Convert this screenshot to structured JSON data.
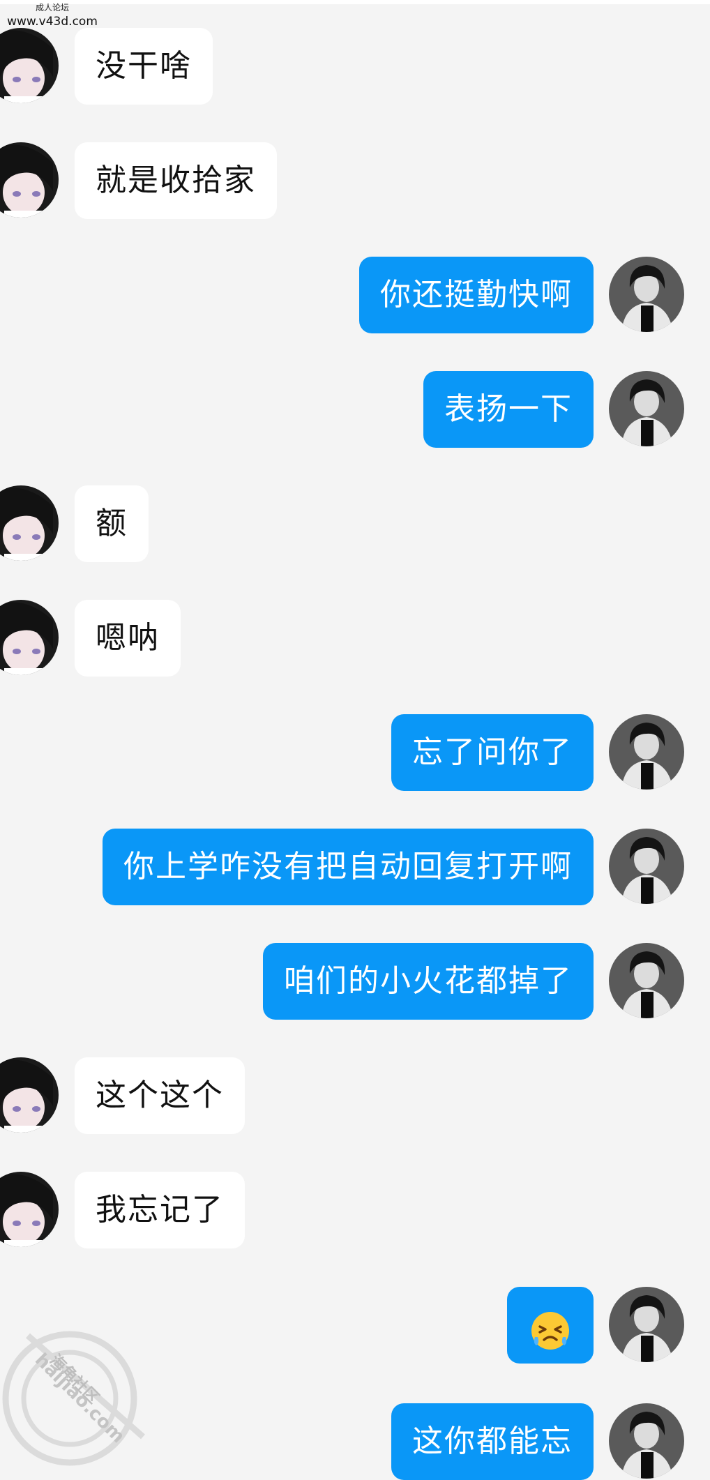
{
  "site_tag": {
    "line1": "成人论坛",
    "line2": "www.v43d.com"
  },
  "watermark": {
    "line1": "海角社区",
    "line2": "haijiao.com"
  },
  "messages": [
    {
      "side": "left",
      "text": "没干啥"
    },
    {
      "side": "left",
      "text": "就是收拾家"
    },
    {
      "side": "right",
      "text": "你还挺勤快啊"
    },
    {
      "side": "right",
      "text": "表扬一下"
    },
    {
      "side": "left",
      "text": "额"
    },
    {
      "side": "left",
      "text": "嗯呐"
    },
    {
      "side": "right",
      "text": "忘了问你了"
    },
    {
      "side": "right",
      "text": "你上学咋没有把自动回复打开啊"
    },
    {
      "side": "right",
      "text": "咱们的小火花都掉了"
    },
    {
      "side": "left",
      "text": "这个这个"
    },
    {
      "side": "left",
      "text": "我忘记了"
    },
    {
      "side": "right",
      "text": "",
      "emoji": "crying-laugh-emoji"
    },
    {
      "side": "right",
      "text": "这你都能忘"
    }
  ],
  "colors": {
    "background": "#f4f4f4",
    "outgoing_bubble": "#0a97f7",
    "incoming_bubble": "#ffffff",
    "outgoing_text": "#ffffff",
    "incoming_text": "#111111"
  }
}
